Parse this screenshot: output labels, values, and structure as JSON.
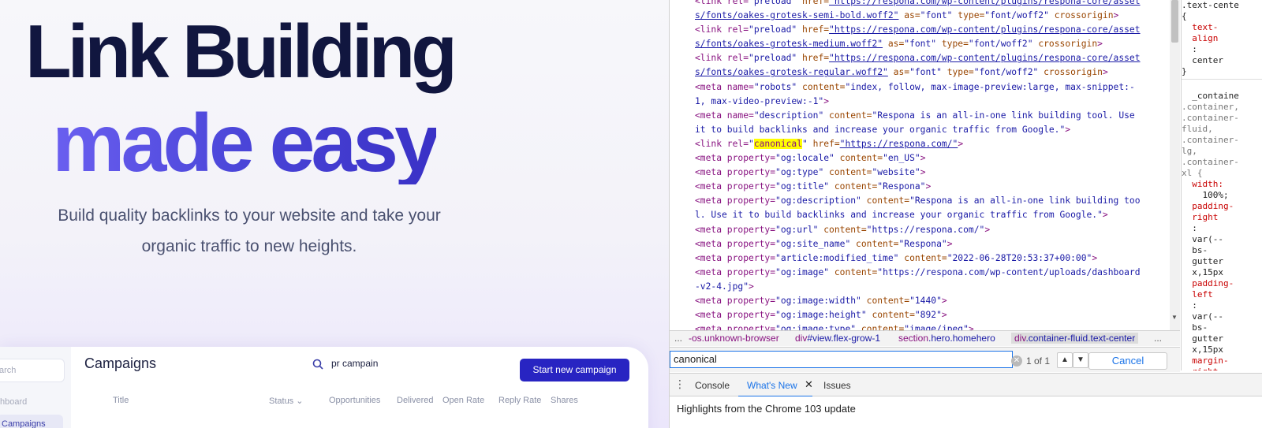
{
  "hero": {
    "line1": "Link Building",
    "line2": "made easy",
    "subtitle_line1": "Build quality backlinks to your website and take your",
    "subtitle_line2": "organic traffic to new heights."
  },
  "dashboard": {
    "side_search_placeholder": "arch",
    "side_dashboard": "hboard",
    "side_campaigns": "Campaigns",
    "title": "Campaigns",
    "search_value": "pr campain",
    "start_button": "Start new campaign",
    "columns": [
      "Title",
      "Status ⌄",
      "Opportunities",
      "Delivered",
      "Open Rate",
      "Reply Rate",
      "Shares"
    ]
  },
  "elements_panel": {
    "lines": [
      [
        [
          "tg",
          "<link rel="
        ],
        [
          "av",
          "\"preload\""
        ],
        [
          "an",
          " href="
        ],
        [
          "lk",
          "\"https://respona.com/wp-content/plugins/respona-core/asset"
        ]
      ],
      [
        [
          "lk",
          "s/fonts/oakes-grotesk-semi-bold.woff2\""
        ],
        [
          "an",
          " as="
        ],
        [
          "av",
          "\"font\""
        ],
        [
          "an",
          " type="
        ],
        [
          "av",
          "\"font/woff2\""
        ],
        [
          "an",
          " crossorigin"
        ],
        [
          "tg",
          ">"
        ]
      ],
      [
        [
          "tg",
          "<link rel="
        ],
        [
          "av",
          "\"preload\""
        ],
        [
          "an",
          " href="
        ],
        [
          "lk",
          "\"https://respona.com/wp-content/plugins/respona-core/asset"
        ]
      ],
      [
        [
          "lk",
          "s/fonts/oakes-grotesk-medium.woff2\""
        ],
        [
          "an",
          " as="
        ],
        [
          "av",
          "\"font\""
        ],
        [
          "an",
          " type="
        ],
        [
          "av",
          "\"font/woff2\""
        ],
        [
          "an",
          " crossorigin"
        ],
        [
          "tg",
          ">"
        ]
      ],
      [
        [
          "tg",
          "<link rel="
        ],
        [
          "av",
          "\"preload\""
        ],
        [
          "an",
          " href="
        ],
        [
          "lk",
          "\"https://respona.com/wp-content/plugins/respona-core/asset"
        ]
      ],
      [
        [
          "lk",
          "s/fonts/oakes-grotesk-regular.woff2\""
        ],
        [
          "an",
          " as="
        ],
        [
          "av",
          "\"font\""
        ],
        [
          "an",
          " type="
        ],
        [
          "av",
          "\"font/woff2\""
        ],
        [
          "an",
          " crossorigin"
        ],
        [
          "tg",
          ">"
        ]
      ],
      [
        [
          "tg",
          "<meta name="
        ],
        [
          "av",
          "\"robots\""
        ],
        [
          "an",
          " content="
        ],
        [
          "av",
          "\"index, follow, max-image-preview:large, max-snippet:-"
        ]
      ],
      [
        [
          "av",
          "1, max-video-preview:-1\""
        ],
        [
          "tg",
          ">"
        ]
      ],
      [
        [
          "tg",
          "<meta name="
        ],
        [
          "av",
          "\"description\""
        ],
        [
          "an",
          " content="
        ],
        [
          "av",
          "\"Respona is an all-in-one link building tool. Use"
        ]
      ],
      [
        [
          "av",
          "it to build backlinks and increase your organic traffic from Google.\""
        ],
        [
          "tg",
          ">"
        ]
      ],
      [
        [
          "tg",
          "<link rel="
        ],
        [
          "av",
          "\""
        ],
        [
          "hl",
          "canonical"
        ],
        [
          "av",
          "\""
        ],
        [
          "an",
          " href="
        ],
        [
          "lk",
          "\"https://respona.com/\""
        ],
        [
          "tg",
          ">"
        ]
      ],
      [
        [
          "tg",
          "<meta property="
        ],
        [
          "av",
          "\"og:locale\""
        ],
        [
          "an",
          " content="
        ],
        [
          "av",
          "\"en_US\""
        ],
        [
          "tg",
          ">"
        ]
      ],
      [
        [
          "tg",
          "<meta property="
        ],
        [
          "av",
          "\"og:type\""
        ],
        [
          "an",
          " content="
        ],
        [
          "av",
          "\"website\""
        ],
        [
          "tg",
          ">"
        ]
      ],
      [
        [
          "tg",
          "<meta property="
        ],
        [
          "av",
          "\"og:title\""
        ],
        [
          "an",
          " content="
        ],
        [
          "av",
          "\"Respona\""
        ],
        [
          "tg",
          ">"
        ]
      ],
      [
        [
          "tg",
          "<meta property="
        ],
        [
          "av",
          "\"og:description\""
        ],
        [
          "an",
          " content="
        ],
        [
          "av",
          "\"Respona is an all-in-one link building too"
        ]
      ],
      [
        [
          "av",
          "l. Use it to build backlinks and increase your organic traffic from Google.\""
        ],
        [
          "tg",
          ">"
        ]
      ],
      [
        [
          "tg",
          "<meta property="
        ],
        [
          "av",
          "\"og:url\""
        ],
        [
          "an",
          " content="
        ],
        [
          "av",
          "\"https://respona.com/\""
        ],
        [
          "tg",
          ">"
        ]
      ],
      [
        [
          "tg",
          "<meta property="
        ],
        [
          "av",
          "\"og:site_name\""
        ],
        [
          "an",
          " content="
        ],
        [
          "av",
          "\"Respona\""
        ],
        [
          "tg",
          ">"
        ]
      ],
      [
        [
          "tg",
          "<meta property="
        ],
        [
          "av",
          "\"article:modified_time\""
        ],
        [
          "an",
          " content="
        ],
        [
          "av",
          "\"2022-06-28T20:53:37+00:00\""
        ],
        [
          "tg",
          ">"
        ]
      ],
      [
        [
          "tg",
          "<meta property="
        ],
        [
          "av",
          "\"og:image\""
        ],
        [
          "an",
          " content="
        ],
        [
          "av",
          "\"https://respona.com/wp-content/uploads/dashboard"
        ]
      ],
      [
        [
          "av",
          "-v2-4.jpg\""
        ],
        [
          "tg",
          ">"
        ]
      ],
      [
        [
          "tg",
          "<meta property="
        ],
        [
          "av",
          "\"og:image:width\""
        ],
        [
          "an",
          " content="
        ],
        [
          "av",
          "\"1440\""
        ],
        [
          "tg",
          ">"
        ]
      ],
      [
        [
          "tg",
          "<meta property="
        ],
        [
          "av",
          "\"og:image:height\""
        ],
        [
          "an",
          " content="
        ],
        [
          "av",
          "\"892\""
        ],
        [
          "tg",
          ">"
        ]
      ],
      [
        [
          "tg",
          "<meta property="
        ],
        [
          "av",
          "\"og:image:type\""
        ],
        [
          "an",
          " content="
        ],
        [
          "av",
          "\"image/jpeg\""
        ],
        [
          "tg",
          ">"
        ]
      ]
    ]
  },
  "styles_panel": {
    "lines": [
      [
        "sel",
        ".text-cente"
      ],
      [
        "sel",
        "{"
      ],
      [
        "prop",
        "  text-"
      ],
      [
        "prop",
        "  align"
      ],
      [
        "val",
        "  :"
      ],
      [
        "val",
        "  center"
      ],
      [
        "sel",
        "}"
      ],
      [
        "dim",
        ""
      ],
      [
        "sel",
        "  _containe"
      ],
      [
        "dim",
        ".container,"
      ],
      [
        "dim",
        ".container-"
      ],
      [
        "dim",
        "fluid,"
      ],
      [
        "dim",
        ".container-"
      ],
      [
        "dim",
        "lg,"
      ],
      [
        "dim",
        ".container-"
      ],
      [
        "dim",
        "xl {"
      ],
      [
        "prop",
        "  width:"
      ],
      [
        "val",
        "    100%;"
      ],
      [
        "prop",
        "  padding-"
      ],
      [
        "prop",
        "  right"
      ],
      [
        "val",
        "  :"
      ],
      [
        "val",
        "  var(--"
      ],
      [
        "val",
        "  bs-"
      ],
      [
        "val",
        "  gutter"
      ],
      [
        "val",
        "  x,15px"
      ],
      [
        "prop",
        "  padding-"
      ],
      [
        "prop",
        "  left"
      ],
      [
        "val",
        "  :"
      ],
      [
        "val",
        "  var(--"
      ],
      [
        "val",
        "  bs-"
      ],
      [
        "val",
        "  gutter"
      ],
      [
        "val",
        "  x,15px"
      ],
      [
        "prop",
        "  margin-"
      ],
      [
        "prop",
        "  right"
      ]
    ]
  },
  "breadcrumbs": {
    "more_left": "...",
    "items": [
      {
        "tag": "-os.unknown-browser",
        "cls": ""
      },
      {
        "tag": "div",
        "cls": "#view.flex-grow-1"
      },
      {
        "tag": "section",
        "cls": ".hero.homehero"
      },
      {
        "tag": "div",
        "cls": ".container-fluid.text-center"
      }
    ],
    "more_right": "..."
  },
  "findbar": {
    "query": "canonical",
    "count": "1 of 1",
    "cancel_label": "Cancel"
  },
  "drawer": {
    "tabs": [
      "Console",
      "What's New",
      "Issues"
    ],
    "body": "Highlights from the Chrome 103 update"
  }
}
